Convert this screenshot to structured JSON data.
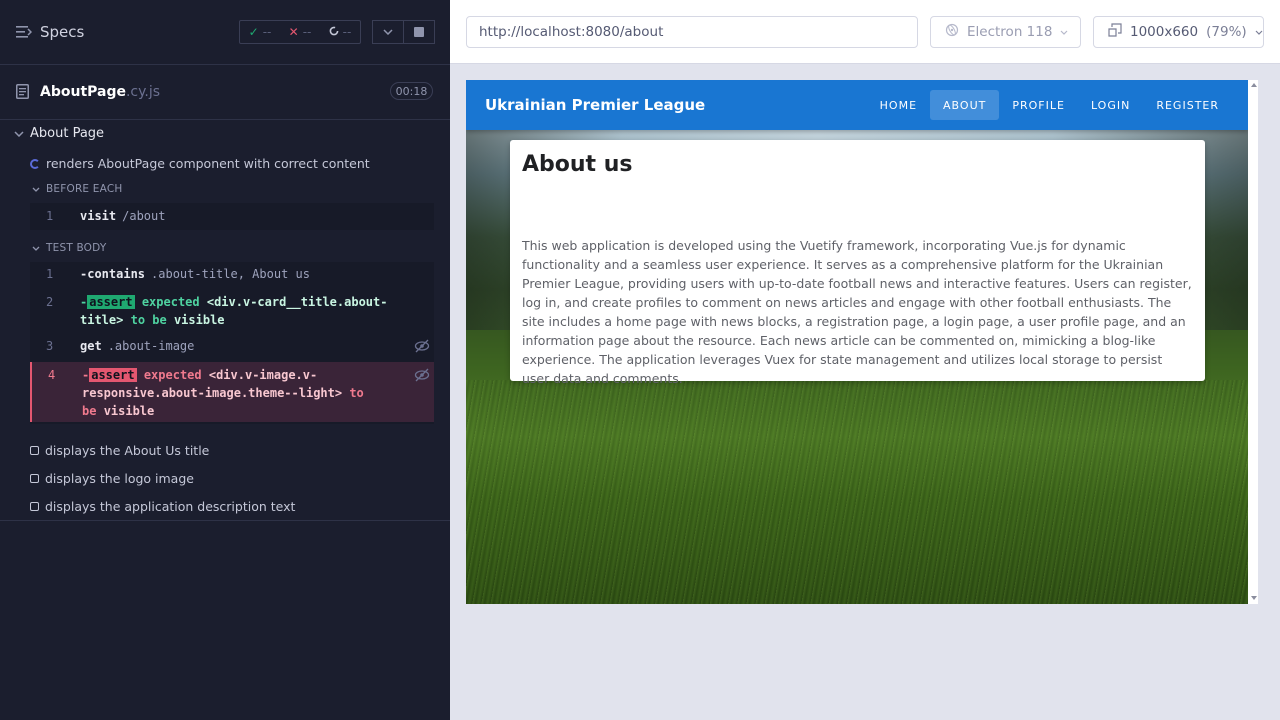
{
  "reporter": {
    "header": {
      "specs_label": "Specs"
    },
    "stats": {
      "passed": "--",
      "failed": "--",
      "pending": "--"
    },
    "file": {
      "name": "AboutPage",
      "ext": ".cy.js",
      "duration": "00:18"
    },
    "suite_title": "About Page",
    "test_title": "renders AboutPage component with correct content",
    "before_each_label": "BEFORE EACH",
    "test_body_label": "TEST BODY",
    "before_commands": [
      {
        "num": "1",
        "name": "visit",
        "arg": "/about"
      }
    ],
    "body_commands": [
      {
        "num": "1",
        "prefix": "-",
        "name": "contains",
        "arg": ".about-title, About us"
      },
      {
        "num": "2",
        "prefix": "-",
        "tag": "assert",
        "expected": "expected",
        "subject": "<div.v-card__title.about-title>",
        "tobe": "to be",
        "state": "visible"
      },
      {
        "num": "3",
        "name": "get",
        "arg": ".about-image"
      },
      {
        "num": "4",
        "prefix": "-",
        "tag": "assert",
        "expected": "expected",
        "subject": "<div.v-image.v-responsive.about-image.theme--light>",
        "tobe": "to be",
        "state": "visible"
      }
    ],
    "pending_tests": [
      "displays the About Us title",
      "displays the logo image",
      "displays the application description text"
    ]
  },
  "topbar": {
    "url": "http://localhost:8080/about",
    "browser": "Electron 118",
    "viewport": "1000x660",
    "zoom": "(79%)"
  },
  "aut": {
    "app_title": "Ukrainian Premier League",
    "nav": [
      "HOME",
      "ABOUT",
      "PROFILE",
      "LOGIN",
      "REGISTER"
    ],
    "active_nav": "ABOUT",
    "card_title": "About us",
    "card_text": "This web application is developed using the Vuetify framework, incorporating Vue.js for dynamic functionality and a seamless user experience. It serves as a comprehensive platform for the Ukrainian Premier League, providing users with up-to-date football news and interactive features. Users can register, log in, and create profiles to comment on news articles and engage with other football enthusiasts. The site includes a home page with news blocks, a registration page, a login page, a user profile page, and an information page about the resource. Each news article can be commented on, mimicking a blog-like experience. The application leverages Vuex for state management and utilizes local storage to persist user data and comments."
  },
  "colors": {
    "reporter_bg": "#1b1e2e",
    "pass": "#1fa971",
    "fail": "#e45770",
    "appbar": "#1976d2"
  },
  "icons": [
    "specs-icon",
    "check-icon",
    "x-icon",
    "pending-icon",
    "chevron-down-icon",
    "stop-icon",
    "document-icon",
    "spinner-icon",
    "eye-slash-icon",
    "browser-icon",
    "viewport-icon"
  ]
}
